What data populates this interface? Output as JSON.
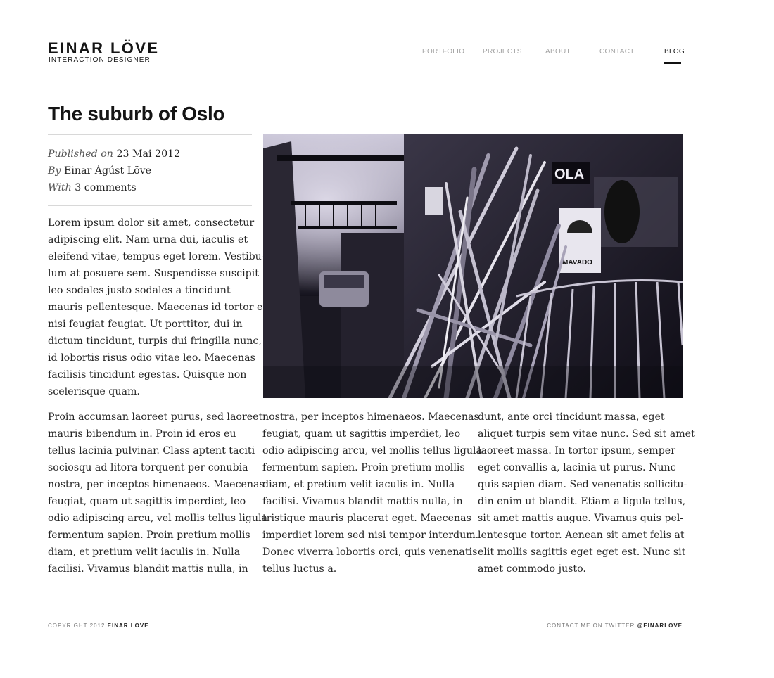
{
  "header": {
    "name": "EINAR LÖVE",
    "tagline": "INTERACTION DESIGNER"
  },
  "nav": {
    "items": [
      {
        "label": "PORTFOLIO",
        "active": false
      },
      {
        "label": "PROJECTS",
        "active": false
      },
      {
        "label": "ABOUT",
        "active": false
      },
      {
        "label": "CONTACT",
        "active": false
      },
      {
        "label": "BLOG",
        "active": true
      }
    ]
  },
  "post": {
    "title": "The suburb of Oslo",
    "meta": {
      "published_label": "Published on",
      "published_date": "23 Mai 2012",
      "by_label": "By",
      "author": "Einar Ágúst Löve",
      "with_label": "With",
      "comments": "3 comments"
    },
    "intro": "Lorem ipsum dolor sit amet, consectetur\nadipiscing elit. Nam urna dui, iaculis et\neleifend vitae, tempus eget lorem. Vestibu-\nlum at posuere sem. Suspendisse suscipit\nleo sodales justo sodales a tincidunt\nmauris pellentesque. Maecenas id tortor et\nnisi feugiat feugiat. Ut porttitor, dui in\ndictum tincidunt, turpis dui fringilla nunc,\nid lobortis risus odio vitae leo. Maecenas\nfacilisis tincidunt egestas. Quisque non\nscelerisque quam.",
    "columns": [
      "Proin accumsan laoreet purus, sed laoreet\nmauris bibendum in. Proin id eros eu\ntellus lacinia pulvinar. Class aptent taciti\nsociosqu ad litora torquent per conubia\nnostra, per inceptos himenaeos. Maecenas\nfeugiat, quam ut sagittis imperdiet, leo\nodio adipiscing arcu, vel mollis tellus ligula\nfermentum sapien. Proin pretium mollis\ndiam, et pretium velit iaculis in. Nulla\nfacilisi. Vivamus blandit mattis nulla, in",
      "nostra, per inceptos himenaeos. Maecenas\nfeugiat, quam ut sagittis imperdiet, leo\nodio adipiscing arcu, vel mollis tellus ligula\nfermentum sapien. Proin pretium mollis\ndiam, et pretium velit iaculis in. Nulla\nfacilisi. Vivamus blandit mattis nulla, in\ntristique mauris placerat eget. Maecenas\nimperdiet lorem sed nisi tempor interdum.\nDonec viverra lobortis orci, quis venenatis\ntellus luctus a.",
      "dunt, ante orci tincidunt massa, eget\naliquet turpis sem vitae nunc. Sed sit amet\nlaoreet massa. In tortor ipsum, semper\neget convallis a, lacinia ut purus. Nunc\nquis sapien diam. Sed venenatis sollicitu-\ndin enim ut blandit. Etiam a ligula tellus,\nsit amet mattis augue. Vivamus quis pel-\nlentesque tortor. Aenean sit amet felis at\nelit mollis sagittis eget eget est. Nunc sit\namet commodo justo."
    ],
    "image": {
      "sign_text_1": "OLA",
      "sign_text_2": "MAVADO"
    }
  },
  "footer": {
    "copyright_prefix": "COPYRIGHT 2012",
    "copyright_name": "EINAR LOVE",
    "contact_prefix": "CONTACT ME ON TWITTER",
    "twitter_handle": "@EINARLOVE"
  },
  "colors": {
    "text": "#1e1e1e",
    "nav_inactive": "#a2a2a2",
    "rule": "#d8d8d8"
  }
}
